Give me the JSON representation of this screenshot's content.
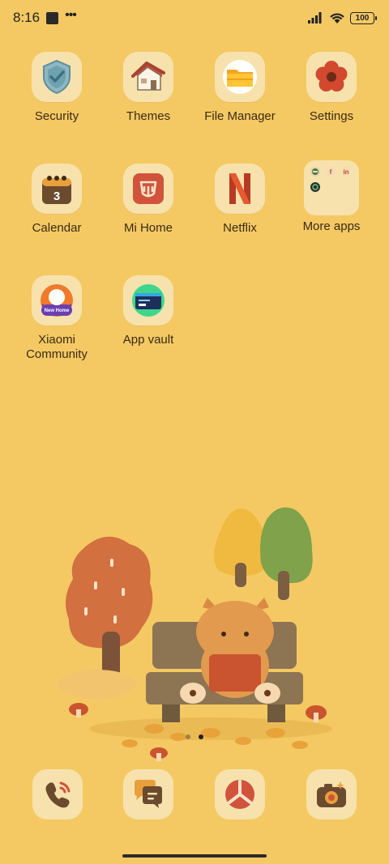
{
  "status_bar": {
    "time": "8:16",
    "battery": "100"
  },
  "apps": [
    {
      "label": "Security",
      "icon": "shield-check-icon"
    },
    {
      "label": "Themes",
      "icon": "house-icon"
    },
    {
      "label": "File Manager",
      "icon": "folder-icon"
    },
    {
      "label": "Settings",
      "icon": "flower-gear-icon"
    },
    {
      "label": "Calendar",
      "icon": "calendar-icon",
      "day": "3"
    },
    {
      "label": "Mi Home",
      "icon": "mi-home-icon"
    },
    {
      "label": "Netflix",
      "icon": "netflix-icon"
    },
    {
      "label": "More apps",
      "icon": "folder-group-icon"
    },
    {
      "label": "Xiaomi\nCommunity",
      "label_line1": "Xiaomi",
      "label_line2": "Community",
      "icon": "xiaomi-community-icon",
      "badge": "New Home"
    },
    {
      "label": "App vault",
      "icon": "app-vault-icon"
    }
  ],
  "folder": {
    "mini_apps": [
      "f",
      "in"
    ]
  },
  "dock": [
    {
      "icon": "phone-icon"
    },
    {
      "icon": "messages-icon"
    },
    {
      "icon": "browser-icon"
    },
    {
      "icon": "camera-icon"
    }
  ],
  "colors": {
    "background": "#F4C963",
    "tile": "#F7E2AD",
    "label": "#3B2A16"
  }
}
